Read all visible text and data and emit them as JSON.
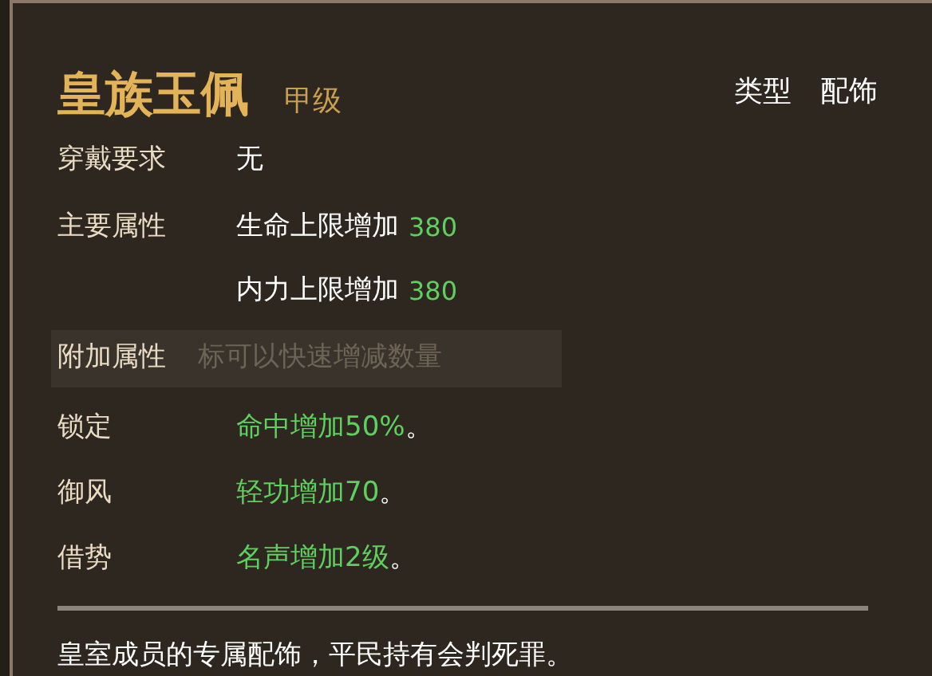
{
  "item": {
    "name": "皇族玉佩",
    "grade": "甲级",
    "type_label": "类型",
    "type_value": "配饰"
  },
  "requirement": {
    "label": "穿戴要求",
    "value": "无"
  },
  "main_attributes": {
    "label": "主要属性",
    "stats": [
      {
        "text": "生命上限增加",
        "value": "380"
      },
      {
        "text": "内力上限增加",
        "value": "380"
      }
    ]
  },
  "extra_attributes": {
    "label": "附加属性",
    "background_hint": "标可以快速增减数量",
    "items": [
      {
        "name": "锁定",
        "effect": "命中增加50%",
        "end": "。"
      },
      {
        "name": "御风",
        "effect": "轻功增加70",
        "end": "。"
      },
      {
        "name": "借势",
        "effect": "名声增加2级",
        "end": "。"
      }
    ]
  },
  "description": "皇室成员的专属配饰，平民持有会判死罪。"
}
